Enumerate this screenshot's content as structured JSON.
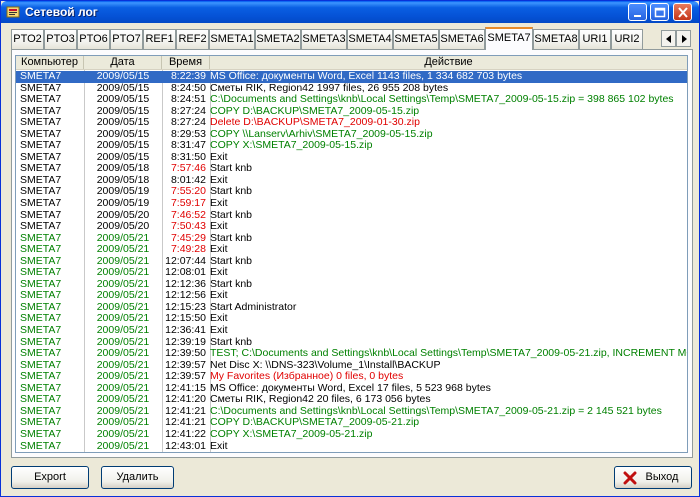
{
  "window": {
    "title": "Сетевой лог",
    "colors": {
      "titlebar": "#0a5fe3",
      "selection": "#316ac5",
      "green_text": "#008000",
      "red_text": "#e00000"
    }
  },
  "tabs": [
    {
      "label": "PTO2",
      "active": false
    },
    {
      "label": "PTO3",
      "active": false
    },
    {
      "label": "PTO6",
      "active": false
    },
    {
      "label": "PTO7",
      "active": false
    },
    {
      "label": "REF1",
      "active": false
    },
    {
      "label": "REF2",
      "active": false
    },
    {
      "label": "SMETA1",
      "active": false
    },
    {
      "label": "SMETA2",
      "active": false
    },
    {
      "label": "SMETA3",
      "active": false
    },
    {
      "label": "SMETA4",
      "active": false
    },
    {
      "label": "SMETA5",
      "active": false
    },
    {
      "label": "SMETA6",
      "active": false
    },
    {
      "label": "SMETA7",
      "active": true
    },
    {
      "label": "SMETA8",
      "active": false
    },
    {
      "label": "URI1",
      "active": false
    },
    {
      "label": "URI2",
      "active": false
    }
  ],
  "table": {
    "columns": [
      "Компьютер",
      "Дата",
      "Время",
      "Действие"
    ],
    "rows": [
      {
        "comp": "SMETA7",
        "date": "2009/05/15",
        "time": "8:22:39",
        "action": "MS Office: документы Word, Excel  1143 files, 1 334 682 703 bytes",
        "row_color": "black",
        "time_color": "black",
        "action_color": "black",
        "selected": true
      },
      {
        "comp": "SMETA7",
        "date": "2009/05/15",
        "time": "8:24:50",
        "action": "Сметы RIK, Region42  1997 files, 26 955 208 bytes",
        "row_color": "black",
        "time_color": "black",
        "action_color": "black",
        "selected": false
      },
      {
        "comp": "SMETA7",
        "date": "2009/05/15",
        "time": "8:24:51",
        "action": "C:\\Documents and Settings\\knb\\Local Settings\\Temp\\SMETA7_2009-05-15.zip = 398 865 102 bytes",
        "row_color": "black",
        "time_color": "black",
        "action_color": "green",
        "selected": false
      },
      {
        "comp": "SMETA7",
        "date": "2009/05/15",
        "time": "8:27:24",
        "action": "COPY D:\\BACKUP\\SMETA7_2009-05-15.zip",
        "row_color": "black",
        "time_color": "black",
        "action_color": "green",
        "selected": false
      },
      {
        "comp": "SMETA7",
        "date": "2009/05/15",
        "time": "8:27:24",
        "action": "Delete D:\\BACKUP\\SMETA7_2009-01-30.zip",
        "row_color": "black",
        "time_color": "black",
        "action_color": "red",
        "selected": false
      },
      {
        "comp": "SMETA7",
        "date": "2009/05/15",
        "time": "8:29:53",
        "action": "COPY \\\\Lanserv\\Arhiv\\SMETA7_2009-05-15.zip",
        "row_color": "black",
        "time_color": "black",
        "action_color": "green",
        "selected": false
      },
      {
        "comp": "SMETA7",
        "date": "2009/05/15",
        "time": "8:31:47",
        "action": "COPY X:\\SMETA7_2009-05-15.zip",
        "row_color": "black",
        "time_color": "black",
        "action_color": "green",
        "selected": false
      },
      {
        "comp": "SMETA7",
        "date": "2009/05/15",
        "time": "8:31:50",
        "action": "Exit",
        "row_color": "black",
        "time_color": "black",
        "action_color": "black",
        "selected": false
      },
      {
        "comp": "SMETA7",
        "date": "2009/05/18",
        "time": "7:57:46",
        "action": "Start knb",
        "row_color": "black",
        "time_color": "red",
        "action_color": "black",
        "selected": false
      },
      {
        "comp": "SMETA7",
        "date": "2009/05/18",
        "time": "8:01:42",
        "action": "Exit",
        "row_color": "black",
        "time_color": "black",
        "action_color": "black",
        "selected": false
      },
      {
        "comp": "SMETA7",
        "date": "2009/05/19",
        "time": "7:55:20",
        "action": "Start knb",
        "row_color": "black",
        "time_color": "red",
        "action_color": "black",
        "selected": false
      },
      {
        "comp": "SMETA7",
        "date": "2009/05/19",
        "time": "7:59:17",
        "action": "Exit",
        "row_color": "black",
        "time_color": "red",
        "action_color": "black",
        "selected": false
      },
      {
        "comp": "SMETA7",
        "date": "2009/05/20",
        "time": "7:46:52",
        "action": "Start knb",
        "row_color": "black",
        "time_color": "red",
        "action_color": "black",
        "selected": false
      },
      {
        "comp": "SMETA7",
        "date": "2009/05/20",
        "time": "7:50:43",
        "action": "Exit",
        "row_color": "black",
        "time_color": "red",
        "action_color": "black",
        "selected": false
      },
      {
        "comp": "SMETA7",
        "date": "2009/05/21",
        "time": "7:45:29",
        "action": "Start knb",
        "row_color": "green",
        "time_color": "red",
        "action_color": "black",
        "selected": false
      },
      {
        "comp": "SMETA7",
        "date": "2009/05/21",
        "time": "7:49:28",
        "action": "Exit",
        "row_color": "green",
        "time_color": "red",
        "action_color": "black",
        "selected": false
      },
      {
        "comp": "SMETA7",
        "date": "2009/05/21",
        "time": "12:07:44",
        "action": "Start knb",
        "row_color": "green",
        "time_color": "black",
        "action_color": "black",
        "selected": false
      },
      {
        "comp": "SMETA7",
        "date": "2009/05/21",
        "time": "12:08:01",
        "action": "Exit",
        "row_color": "green",
        "time_color": "black",
        "action_color": "black",
        "selected": false
      },
      {
        "comp": "SMETA7",
        "date": "2009/05/21",
        "time": "12:12:36",
        "action": "Start knb",
        "row_color": "green",
        "time_color": "black",
        "action_color": "black",
        "selected": false
      },
      {
        "comp": "SMETA7",
        "date": "2009/05/21",
        "time": "12:12:56",
        "action": "Exit",
        "row_color": "green",
        "time_color": "black",
        "action_color": "black",
        "selected": false
      },
      {
        "comp": "SMETA7",
        "date": "2009/05/21",
        "time": "12:15:23",
        "action": "Start Administrator",
        "row_color": "green",
        "time_color": "black",
        "action_color": "black",
        "selected": false
      },
      {
        "comp": "SMETA7",
        "date": "2009/05/21",
        "time": "12:15:50",
        "action": "Exit",
        "row_color": "green",
        "time_color": "black",
        "action_color": "black",
        "selected": false
      },
      {
        "comp": "SMETA7",
        "date": "2009/05/21",
        "time": "12:36:41",
        "action": "Exit",
        "row_color": "green",
        "time_color": "black",
        "action_color": "black",
        "selected": false
      },
      {
        "comp": "SMETA7",
        "date": "2009/05/21",
        "time": "12:39:19",
        "action": "Start knb",
        "row_color": "green",
        "time_color": "black",
        "action_color": "black",
        "selected": false
      },
      {
        "comp": "SMETA7",
        "date": "2009/05/21",
        "time": "12:39:50",
        "action": "TEST;  C:\\Documents and Settings\\knb\\Local Settings\\Temp\\SMETA7_2009-05-21.zip,  INCREMENT MODE=1",
        "row_color": "green",
        "time_color": "black",
        "action_color": "green",
        "selected": false
      },
      {
        "comp": "SMETA7",
        "date": "2009/05/21",
        "time": "12:39:57",
        "action": "Net Disc X:  \\\\DNS-323\\Volume_1\\Install\\BACKUP",
        "row_color": "green",
        "time_color": "black",
        "action_color": "black",
        "selected": false
      },
      {
        "comp": "SMETA7",
        "date": "2009/05/21",
        "time": "12:39:57",
        "action": "My Favorites (Избранное)  0 files, 0 bytes",
        "row_color": "green",
        "time_color": "black",
        "action_color": "red",
        "selected": false
      },
      {
        "comp": "SMETA7",
        "date": "2009/05/21",
        "time": "12:41:15",
        "action": "MS Office: документы Word, Excel  17 files, 5 523 968 bytes",
        "row_color": "green",
        "time_color": "black",
        "action_color": "black",
        "selected": false
      },
      {
        "comp": "SMETA7",
        "date": "2009/05/21",
        "time": "12:41:20",
        "action": "Сметы RIK, Region42  20 files, 6 173 056 bytes",
        "row_color": "green",
        "time_color": "black",
        "action_color": "black",
        "selected": false
      },
      {
        "comp": "SMETA7",
        "date": "2009/05/21",
        "time": "12:41:21",
        "action": "C:\\Documents and Settings\\knb\\Local Settings\\Temp\\SMETA7_2009-05-21.zip = 2 145 521 bytes",
        "row_color": "green",
        "time_color": "black",
        "action_color": "green",
        "selected": false
      },
      {
        "comp": "SMETA7",
        "date": "2009/05/21",
        "time": "12:41:21",
        "action": "COPY D:\\BACKUP\\SMETA7_2009-05-21.zip",
        "row_color": "green",
        "time_color": "black",
        "action_color": "green",
        "selected": false
      },
      {
        "comp": "SMETA7",
        "date": "2009/05/21",
        "time": "12:41:22",
        "action": "COPY X:\\SMETA7_2009-05-21.zip",
        "row_color": "green",
        "time_color": "black",
        "action_color": "green",
        "selected": false
      },
      {
        "comp": "SMETA7",
        "date": "2009/05/21",
        "time": "12:43:01",
        "action": "Exit",
        "row_color": "green",
        "time_color": "black",
        "action_color": "black",
        "selected": false
      }
    ]
  },
  "buttons": {
    "export_label": "Export",
    "delete_label": "Удалить",
    "exit_label": "Выход",
    "exit_icon": "red-x-icon"
  }
}
